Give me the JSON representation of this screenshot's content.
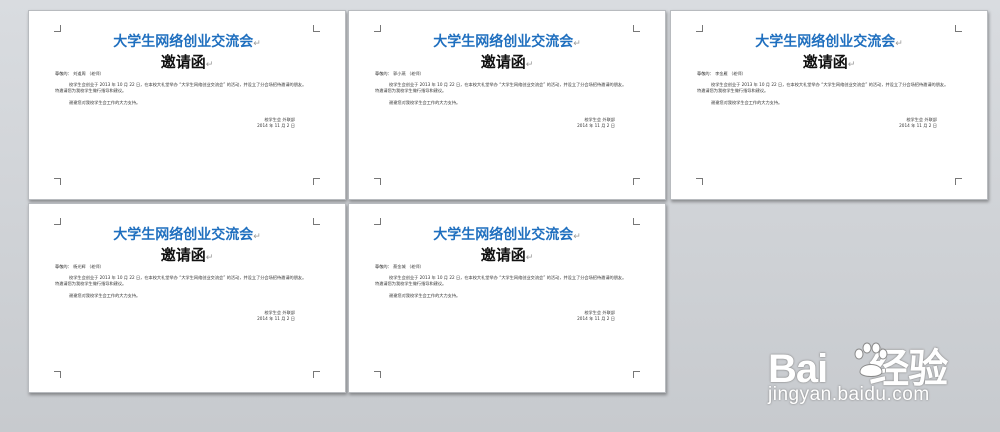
{
  "pages": [
    {
      "title": "大学生网络创业交流会",
      "subtitle": "邀请函",
      "greeting": "尊敬的： 刘道周 （老师）",
      "body1": "校学生会创业于 2013 年 10 月 22 日，在本校大礼堂举办 “大学生网络创业交流会” 的活动，并设立了分会场招待邀请的朋友。",
      "body2": "特邀请您为我校学生做行指导和建议。",
      "body3": "谢谢您对我校学生会工作的大力支持。",
      "sign1": "校学生会 外联部",
      "sign2": "2014 年 11 月 2 日",
      "para_mark": "↵"
    },
    {
      "title": "大学生网络创业交流会",
      "subtitle": "邀请函",
      "greeting": "尊敬的： 郭小燕 （老师）",
      "body1": "校学生会创业于 2013 年 10 月 22 日，在本校大礼堂举办 “大学生网络创业交流会” 的活动，并设立了分会场招待邀请的朋友。",
      "body2": "特邀请您为我校学生做行指导和建议。",
      "body3": "谢谢您对我校学生会工作的大力支持。",
      "sign1": "校学生会 外联部",
      "sign2": "2014 年 11 月 2 日",
      "para_mark": "↵"
    },
    {
      "title": "大学生网络创业交流会",
      "subtitle": "邀请函",
      "greeting": "尊敬的： 李金雁 （老师）",
      "body1": "校学生会创业于 2013 年 10 月 22 日，在本校大礼堂举办 “大学生网络创业交流会” 的活动，并设立了分会场招待邀请的朋友。",
      "body2": "特邀请您为我校学生做行指导和建议。",
      "body3": "谢谢您对我校学生会工作的大力支持。",
      "sign1": "校学生会 外联部",
      "sign2": "2014 年 11 月 2 日",
      "para_mark": "↵"
    },
    {
      "title": "大学生网络创业交流会",
      "subtitle": "邀请函",
      "greeting": "尊敬的： 杨光辉 （老师）",
      "body1": "校学生会创业于 2013 年 10 月 22 日，在本校大礼堂举办 “大学生网络创业交流会” 的活动，并设立了分会场招待邀请的朋友。",
      "body2": "特邀请您为我校学生做行指导和建议。",
      "body3": "谢谢您对我校学生会工作的大力支持。",
      "sign1": "校学生会 外联部",
      "sign2": "2014 年 11 月 2 日",
      "para_mark": "↵"
    },
    {
      "title": "大学生网络创业交流会",
      "subtitle": "邀请函",
      "greeting": "尊敬的： 蔡金城 （老师）",
      "body1": "校学生会创业于 2013 年 10 月 22 日，在本校大礼堂举办 “大学生网络创业交流会” 的活动，并设立了分会场招待邀请的朋友。",
      "body2": "特邀请您为我校学生做行指导和建议。",
      "body3": "谢谢您对我校学生会工作的大力支持。",
      "sign1": "校学生会 外联部",
      "sign2": "2014 年 11 月 2 日",
      "para_mark": "↵"
    }
  ],
  "watermark": {
    "logo_left": "Bai",
    "logo_right": "经验",
    "url": "jingyan.baidu.com"
  }
}
